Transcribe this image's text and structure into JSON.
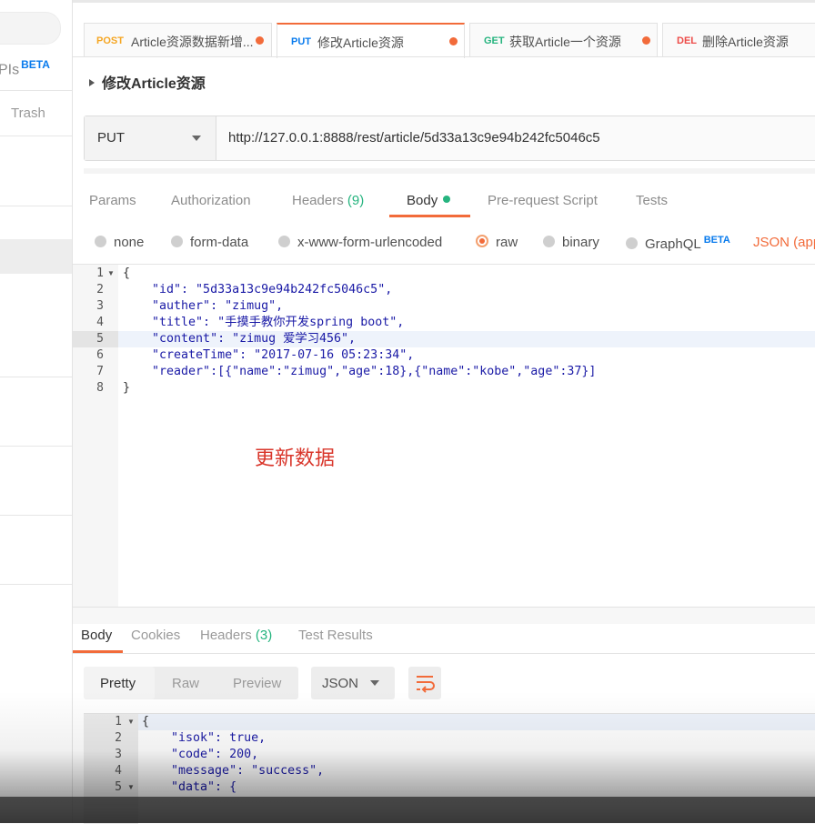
{
  "sidebar": {
    "apis_label": "PIs",
    "apis_badge": "BETA",
    "trash_label": "Trash"
  },
  "tabs": [
    {
      "method": "POST",
      "title": "Article资源数据新增...",
      "method_color": "#f5a623"
    },
    {
      "method": "PUT",
      "title": "修改Article资源",
      "method_color": "#097bed"
    },
    {
      "method": "GET",
      "title": "获取Article一个资源",
      "method_color": "#26b47f"
    },
    {
      "method": "DEL",
      "title": "删除Article资源",
      "method_color": "#ed4b48"
    }
  ],
  "request": {
    "name": "修改Article资源",
    "method": "PUT",
    "url": "http://127.0.0.1:8888/rest/article/5d33a13c9e94b242fc5046c5"
  },
  "request_tabs": {
    "params": "Params",
    "authorization": "Authorization",
    "headers": "Headers",
    "headers_count": "(9)",
    "body": "Body",
    "prerequest": "Pre-request Script",
    "tests": "Tests"
  },
  "body_modes": {
    "none": "none",
    "form_data": "form-data",
    "urlencoded": "x-www-form-urlencoded",
    "raw": "raw",
    "binary": "binary",
    "graphql": "GraphQL",
    "graphql_badge": "BETA",
    "language": "JSON (app"
  },
  "editor": {
    "lines": [
      "1",
      "2",
      "3",
      "4",
      "5",
      "6",
      "7",
      "8"
    ],
    "code": [
      "{",
      "    \"id\": \"5d33a13c9e94b242fc5046c5\",",
      "    \"auther\": \"zimug\",",
      "    \"title\": \"手摸手教你开发spring boot\",",
      "    \"content\": \"zimug 爱学习456\",",
      "    \"createTime\": \"2017-07-16 05:23:34\",",
      "    \"reader\":[{\"name\":\"zimug\",\"age\":18},{\"name\":\"kobe\",\"age\":37}]",
      "}"
    ],
    "annotation": "更新数据"
  },
  "response_tabs": {
    "body": "Body",
    "cookies": "Cookies",
    "headers": "Headers",
    "headers_count": "(3)",
    "test_results": "Test Results"
  },
  "response_format": {
    "pretty": "Pretty",
    "raw": "Raw",
    "preview": "Preview",
    "language": "JSON"
  },
  "response": {
    "lines": [
      "1",
      "2",
      "3",
      "4",
      "5"
    ],
    "code": [
      "{",
      "    \"isok\": true,",
      "    \"code\": 200,",
      "    \"message\": \"success\",",
      "    \"data\": {"
    ]
  },
  "colors": {
    "accent": "#f26b3a",
    "success": "#26b47f",
    "beta": "#097bed",
    "annotation": "#d9362b"
  }
}
